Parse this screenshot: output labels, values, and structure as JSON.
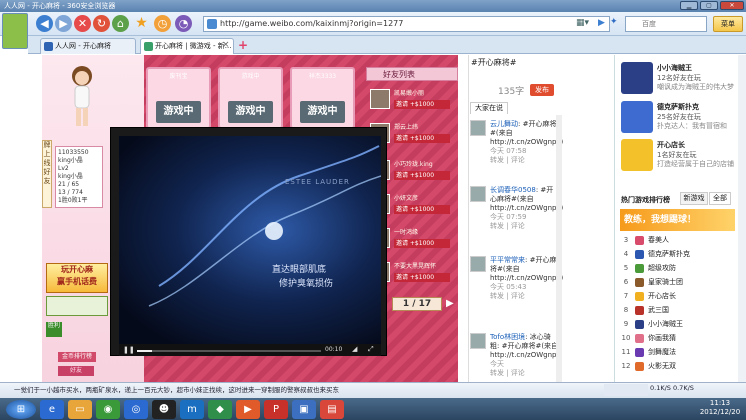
{
  "window": {
    "title": "人人网 - 开心麻将 - 360安全浏览器"
  },
  "toolbar": {
    "url": "http://game.weibo.com/kaixinmj?origin=1277",
    "search_placeholder": "百度",
    "menu_label": "菜单"
  },
  "tabs": [
    {
      "label": "人人网 - 开心麻将"
    },
    {
      "label": "开心麻将 | 微游戏 - 新..."
    }
  ],
  "game": {
    "cells": [
      {
        "label": "废刊宝",
        "status": "游戏中"
      },
      {
        "label": "游戏中",
        "status": "游戏中"
      },
      {
        "label": "祥杰3333",
        "status": "游戏中"
      }
    ],
    "friend_list_title": "好友列表",
    "friends": [
      {
        "name": "凯易嫩小丽",
        "invite": "邀请 +$1000"
      },
      {
        "name": "郑云上纬",
        "invite": "邀请 +$1000"
      },
      {
        "name": "小巧玲珑.king",
        "invite": "邀请 +$1000"
      },
      {
        "name": "小妍文彦",
        "invite": "邀请 +$1000"
      },
      {
        "name": "一时鸿缘",
        "invite": "邀请 +$1000"
      },
      {
        "name": "不要大黑晃辉怀",
        "invite": "邀请 +$1000"
      }
    ],
    "side_tab": "牌上线好友",
    "player_info": [
      "11033550",
      "king小晶",
      "Lv2",
      "king小晶",
      "21 / 65",
      "13 / 774",
      "1胜0败1平"
    ],
    "promo_lines": [
      "玩开心麻",
      "赢手机话费"
    ],
    "win_label": "胜利",
    "quick_label": "快速",
    "friend_btn": "好友",
    "rank_label": "金币排行榜",
    "pager": "1 / 17"
  },
  "video": {
    "brand": "ESTEE LAUDER",
    "caption1": "直达眼部肌底",
    "caption2": "修护臭氧损伤",
    "time": "00:10"
  },
  "weibo": {
    "input_text": "#开心麻将#",
    "count": "135字",
    "send": "发布",
    "tab": "大家在说",
    "posts": [
      {
        "user": "云儿舞动",
        "text": "#开心麻将#(来自http://t.cn/zOWgnpk)",
        "time": "今天 07:58",
        "actions": "转发 | 评论"
      },
      {
        "user": "长调春华0508",
        "text": "#开心麻将#(来自http://t.cn/zOWgnpk)",
        "time": "今天 07:59",
        "actions": "转发 | 评论"
      },
      {
        "user": "平平常常来",
        "text": "#开心麻将#(来自http://t.cn/zOWgnpk)",
        "time": "今天 05:43",
        "actions": "转发 | 评论"
      },
      {
        "user": "Tofo林困境",
        "text": "冰心骑粗: #开心麻将#(来自http://t.cn/zOWgnpk)",
        "time": "今天",
        "actions": "转发 | 评论"
      }
    ]
  },
  "right": {
    "games": [
      {
        "title": "小小海贼王",
        "line1": "12名好友在玩",
        "line2": "嘲讽成为海贼王的伟大梦"
      },
      {
        "title": "德克萨斯扑克",
        "line1": "25名好友在玩",
        "line2": "扑克达人：我有冒宿和"
      },
      {
        "title": "开心店长",
        "line1": "1名好友在玩",
        "line2": "打造经营属于自己的店铺"
      }
    ],
    "rank_title": "热门游戏排行榜",
    "rank_tabs": [
      "新游戏",
      "全部"
    ],
    "banner": "教练，我想踢球！",
    "ranks": [
      {
        "n": "3",
        "name": "春美人"
      },
      {
        "n": "4",
        "name": "德克萨斯扑克"
      },
      {
        "n": "5",
        "name": "超级攻防"
      },
      {
        "n": "6",
        "name": "皇家骑士团"
      },
      {
        "n": "7",
        "name": "开心店长"
      },
      {
        "n": "8",
        "name": "武三国"
      },
      {
        "n": "9",
        "name": "小小海贼王"
      },
      {
        "n": "10",
        "name": "你画我猜"
      },
      {
        "n": "11",
        "name": "剑舞魔法"
      },
      {
        "n": "12",
        "name": "火影无双"
      }
    ]
  },
  "status": {
    "text": "一觉们于一小越市买水，两瓶矿泉水，递上一百元大钞，超市小妹正找续，这时进来一穿制服的警察叔叔也来买东",
    "speed": "0.1K/S  0.7K/S"
  },
  "clock": {
    "time": "11:13",
    "date": "2012/12/20"
  }
}
